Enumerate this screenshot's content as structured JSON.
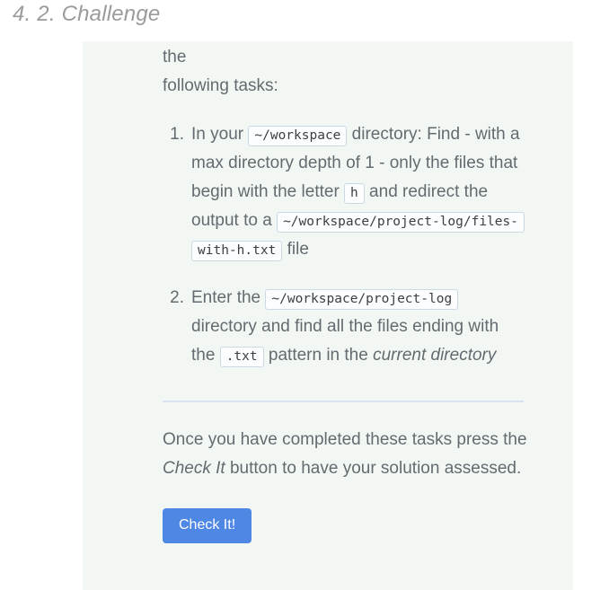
{
  "page": {
    "title": "4. 2. Challenge"
  },
  "card": {
    "intro_clipped_line": "Complete the following exercise, by performing the",
    "intro": "following tasks:",
    "tasks": [
      {
        "id": "task-1",
        "seg_1": "In your ",
        "code_1": "~/workspace",
        "seg_2": " directory: Find - with a max directory depth of 1 - only the files that begin with the letter ",
        "code_2": "h",
        "seg_3": " and redirect the output to a ",
        "code_3": "~/workspace/project-log/files-with-h.txt",
        "seg_4": " file"
      },
      {
        "id": "task-2",
        "seg_1": "Enter the ",
        "code_1": "~/workspace/project-log",
        "seg_2": " directory and find all the files ending with the ",
        "code_2": ".txt",
        "seg_3": " pattern in the ",
        "emphasis": "current directory",
        "seg_4": ""
      }
    ],
    "closing": {
      "seg_1": "Once you have completed these tasks press the ",
      "emphasis": "Check It",
      "seg_2": " button to have your solution assessed."
    },
    "button": {
      "label": "Check It!"
    }
  },
  "colors": {
    "page_background": "#ffffff",
    "card_background": "#f3f7f4",
    "title_text": "#9b9b9b",
    "body_text": "#646a6f",
    "code_text": "#3b4045",
    "code_background": "#fbfdfe",
    "code_border": "#ccd8e4",
    "divider": "#dae2f0",
    "button_background": "#4f87e4",
    "button_text": "#ffffff"
  }
}
